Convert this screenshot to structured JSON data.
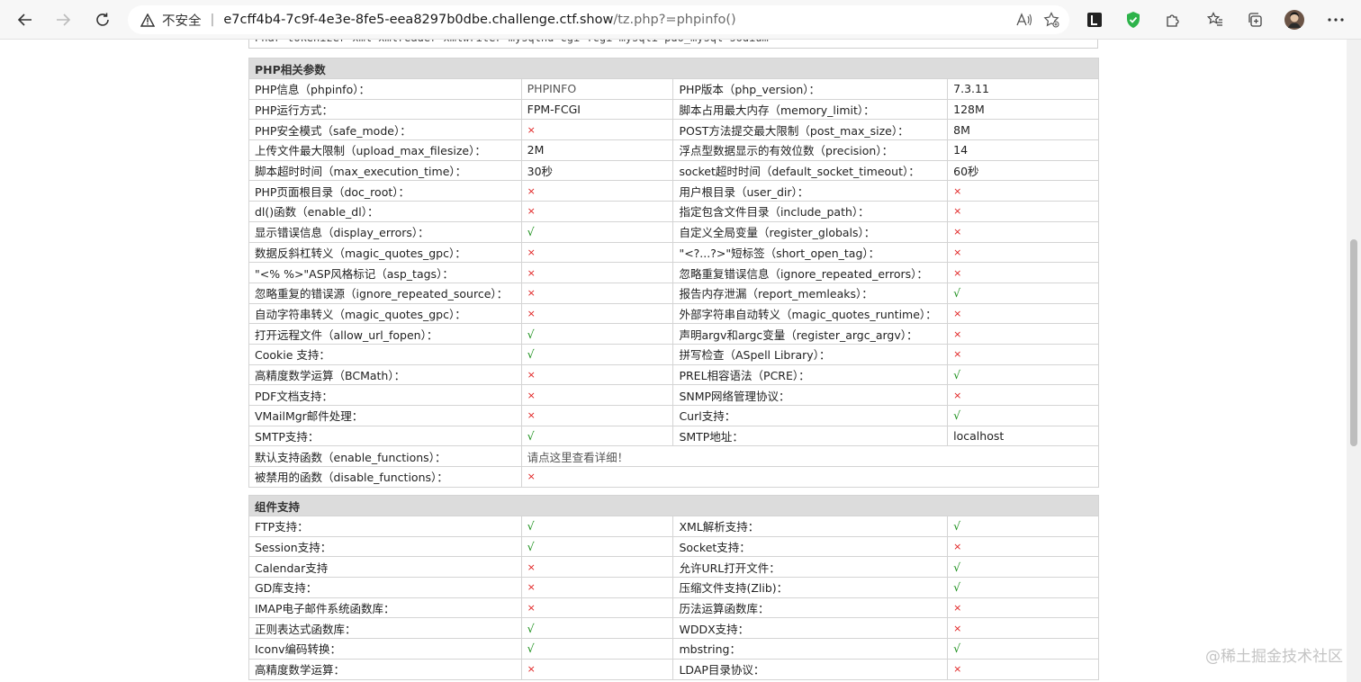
{
  "browser": {
    "security_label": "不安全",
    "url_host": "e7cff4b4-7c9f-4e3e-8fe5-eea8297b0dbe.challenge.ctf.show",
    "url_path": "/tz.php?=phpinfo()"
  },
  "page": {
    "cutoff_text": "Phar  tokenizer  xml  xmlreader  xmlwriter  mysqlnd  cgi-fcgi  mysqli  pdo_mysql  sodium",
    "watermark": "@稀土掘金技术社区"
  },
  "php_params": {
    "title": "PHP相关参数",
    "rows": [
      [
        "PHP信息（phpinfo）：",
        "PHPINFO",
        "PHP版本（php_version）：",
        "7.3.11"
      ],
      [
        "PHP运行方式：",
        "FPM-FCGI",
        "脚本占用最大内存（memory_limit）：",
        "128M"
      ],
      [
        "PHP安全模式（safe_mode）：",
        "×",
        "POST方法提交最大限制（post_max_size）：",
        "8M"
      ],
      [
        "上传文件最大限制（upload_max_filesize）：",
        "2M",
        "浮点型数据显示的有效位数（precision）：",
        "14"
      ],
      [
        "脚本超时时间（max_execution_time）：",
        "30秒",
        "socket超时时间（default_socket_timeout）：",
        "60秒"
      ],
      [
        "PHP页面根目录（doc_root）：",
        "×",
        "用户根目录（user_dir）：",
        "×"
      ],
      [
        "dl()函数（enable_dl）：",
        "×",
        "指定包含文件目录（include_path）：",
        "×"
      ],
      [
        "显示错误信息（display_errors）：",
        "√",
        "自定义全局变量（register_globals）：",
        "×"
      ],
      [
        "数据反斜杠转义（magic_quotes_gpc）：",
        "×",
        "\"<?...?>\"短标签（short_open_tag）：",
        "×"
      ],
      [
        "\"<% %>\"ASP风格标记（asp_tags）：",
        "×",
        "忽略重复错误信息（ignore_repeated_errors）：",
        "×"
      ],
      [
        "忽略重复的错误源（ignore_repeated_source）：",
        "×",
        "报告内存泄漏（report_memleaks）：",
        "√"
      ],
      [
        "自动字符串转义（magic_quotes_gpc）：",
        "×",
        "外部字符串自动转义（magic_quotes_runtime）：",
        "×"
      ],
      [
        "打开远程文件（allow_url_fopen）：",
        "√",
        "声明argv和argc变量（register_argc_argv）：",
        "×"
      ],
      [
        "Cookie 支持：",
        "√",
        "拼写检查（ASpell Library）：",
        "×"
      ],
      [
        "高精度数学运算（BCMath）：",
        "×",
        "PREL相容语法（PCRE）：",
        "√"
      ],
      [
        "PDF文档支持：",
        "×",
        "SNMP网络管理协议：",
        "×"
      ],
      [
        "VMailMgr邮件处理：",
        "×",
        "Curl支持：",
        "√"
      ],
      [
        "SMTP支持：",
        "√",
        "SMTP地址：",
        "localhost"
      ]
    ],
    "enable_functions_label": "默认支持函数（enable_functions）：",
    "enable_functions_link": "请点这里查看详细！",
    "disable_functions_label": "被禁用的函数（disable_functions）：",
    "disable_functions_value": "×"
  },
  "components": {
    "title": "组件支持",
    "rows": [
      [
        "FTP支持：",
        "√",
        "XML解析支持：",
        "√"
      ],
      [
        "Session支持：",
        "√",
        "Socket支持：",
        "×"
      ],
      [
        "Calendar支持",
        "×",
        "允许URL打开文件：",
        "√"
      ],
      [
        "GD库支持：",
        "×",
        "压缩文件支持(Zlib)：",
        "√"
      ],
      [
        "IMAP电子邮件系统函数库：",
        "×",
        "历法运算函数库：",
        "×"
      ],
      [
        "正则表达式函数库：",
        "√",
        "WDDX支持：",
        "×"
      ],
      [
        "Iconv编码转换：",
        "√",
        "mbstring：",
        "√"
      ],
      [
        "高精度数学运算：",
        "×",
        "LDAP目录协议：",
        "×"
      ]
    ]
  }
}
